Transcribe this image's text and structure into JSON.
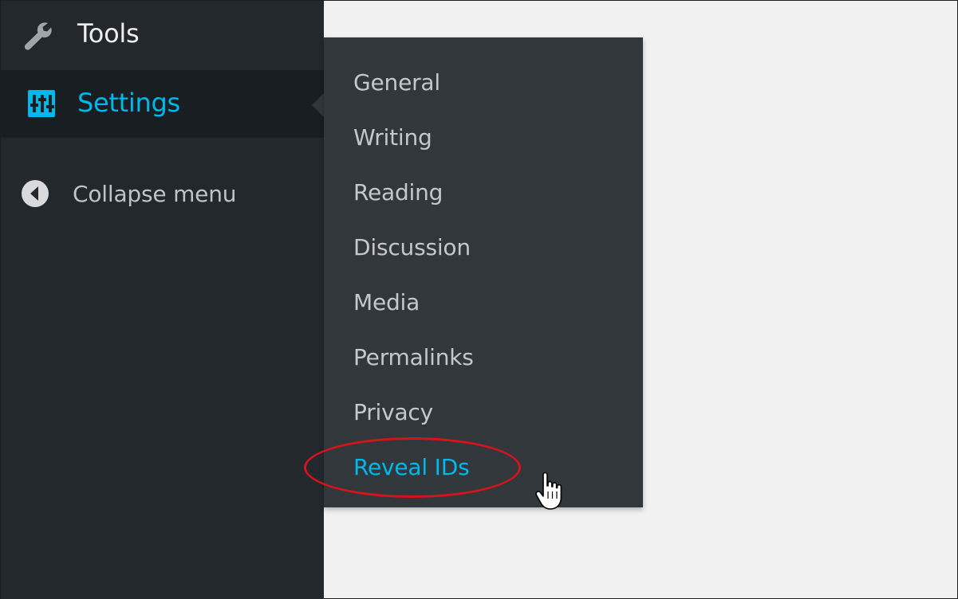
{
  "sidebar": {
    "items": [
      {
        "label": "Tools",
        "icon": "wrench-icon"
      },
      {
        "label": "Settings",
        "icon": "sliders-icon"
      },
      {
        "label": "Collapse menu",
        "icon": "collapse-arrow-icon"
      }
    ]
  },
  "flyout": {
    "items": [
      {
        "label": "General"
      },
      {
        "label": "Writing"
      },
      {
        "label": "Reading"
      },
      {
        "label": "Discussion"
      },
      {
        "label": "Media"
      },
      {
        "label": "Permalinks"
      },
      {
        "label": "Privacy"
      },
      {
        "label": "Reveal IDs"
      }
    ],
    "active": "Reveal IDs"
  },
  "colors": {
    "sidebar_bg": "#23282d",
    "active_bg": "#191e23",
    "flyout_bg": "#32373c",
    "accent": "#00b9eb",
    "highlight": "#d4141a",
    "content_bg": "#f1f1f1"
  }
}
